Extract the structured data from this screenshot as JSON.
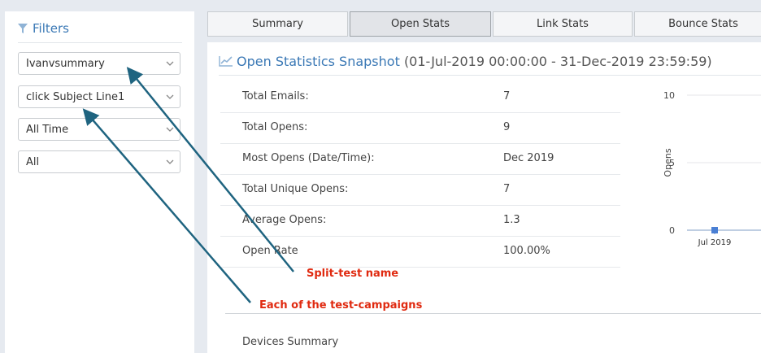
{
  "sidebar": {
    "title": "Filters",
    "icon": "filter-icon",
    "filters": [
      {
        "value": "Ivanvsummary"
      },
      {
        "value": "click Subject Line1"
      },
      {
        "value": "All Time"
      },
      {
        "value": "All"
      }
    ]
  },
  "tabs": [
    {
      "label": "Summary",
      "active": false
    },
    {
      "label": "Open Stats",
      "active": true
    },
    {
      "label": "Link Stats",
      "active": false
    },
    {
      "label": "Bounce Stats",
      "active": false
    }
  ],
  "snapshot": {
    "title": "Open Statistics Snapshot",
    "range": "(01-Jul-2019 00:00:00 - 31-Dec-2019 23:59:59)",
    "icon": "line-chart-icon",
    "rows": [
      {
        "label": "Total Emails:",
        "value": "7"
      },
      {
        "label": "Total Opens:",
        "value": "9"
      },
      {
        "label": "Most Opens (Date/Time):",
        "value": "Dec 2019"
      },
      {
        "label": "Total Unique Opens:",
        "value": "7"
      },
      {
        "label": "Average Opens:",
        "value": "1.3"
      },
      {
        "label": "Open Rate",
        "value": "100.00%"
      }
    ]
  },
  "devices": {
    "title": "Devices Summary"
  },
  "annotations": {
    "split_test": "Split-test name",
    "campaigns": "Each of the test-campaigns"
  },
  "colors": {
    "accent": "#3a78b5",
    "annotation": "#e02a10",
    "arrow": "#1f6480",
    "point": "#4a7fd4"
  },
  "chart_data": {
    "type": "line",
    "ylabel": "Opens",
    "yticks": [
      0,
      5,
      10
    ],
    "ylim": [
      0,
      10
    ],
    "categories": [
      "Jul 2019"
    ],
    "series": [
      {
        "values": [
          0
        ]
      }
    ],
    "grid": true
  }
}
